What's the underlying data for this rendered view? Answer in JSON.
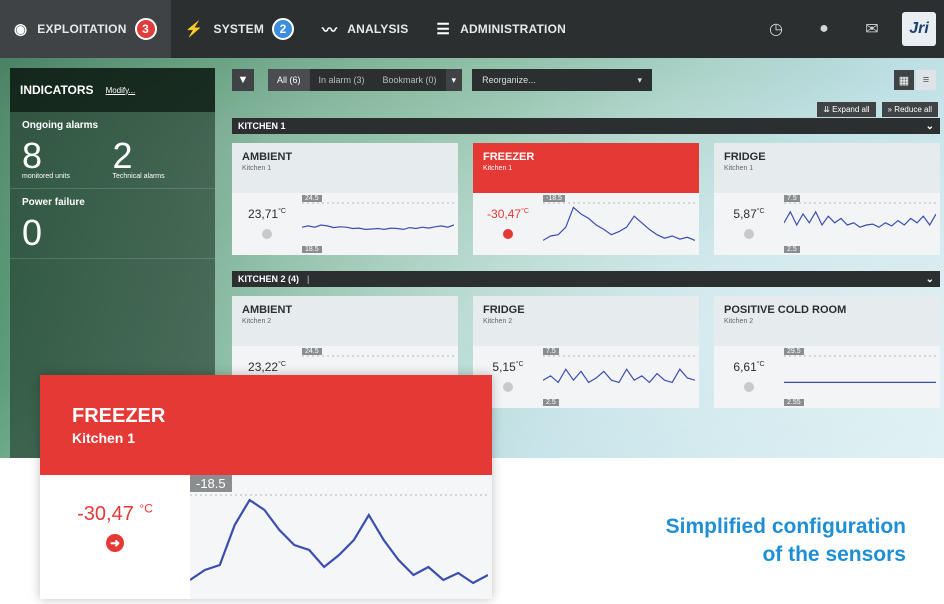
{
  "nav": {
    "exploitation": "EXPLOITATION",
    "exploitation_badge": "3",
    "system": "SYSTEM",
    "system_badge": "2",
    "analysis": "ANALYSIS",
    "administration": "ADMINISTRATION",
    "logo": "Jri",
    "icons": [
      "eye-icon",
      "bolt-icon",
      "chart-line-icon",
      "sliders-icon",
      "clock-icon",
      "user-icon",
      "mail-icon"
    ]
  },
  "indicators": {
    "title": "INDICATORS",
    "modify": "Modify...",
    "ongoing_alarms": "Ongoing alarms",
    "monitored_units_value": "8",
    "monitored_units_label": "monitored units",
    "technical_alarms_value": "2",
    "technical_alarms_label": "Technical alarms",
    "power_failure": "Power failure",
    "power_failure_value": "0"
  },
  "toolbar": {
    "tabs": [
      "All (6)",
      "In alarm (3)",
      "Bookmark (0)"
    ],
    "reorganize": "Reorganize...",
    "expand_all": "Expand all",
    "reduce_all": "Reduce all"
  },
  "groups": [
    {
      "title": "KITCHEN 1",
      "cards": [
        {
          "title": "AMBIENT",
          "sub": "Kitchen 1",
          "value": "23,71",
          "unit": "°C",
          "tick_top": "24.5",
          "tick_bot": "18.5",
          "alarm": false,
          "series": [
            0.55,
            0.52,
            0.55,
            0.5,
            0.52,
            0.56,
            0.54,
            0.55,
            0.58,
            0.57,
            0.6,
            0.59,
            0.58,
            0.6,
            0.57,
            0.58,
            0.6,
            0.56,
            0.58,
            0.55,
            0.57,
            0.54,
            0.52,
            0.55,
            0.5
          ]
        },
        {
          "title": "FREEZER",
          "sub": "Kitchen 1",
          "value": "-30,47",
          "unit": "°C",
          "tick_top": "-18.5",
          "tick_bot": "",
          "alarm": true,
          "series": [
            0.85,
            0.75,
            0.72,
            0.55,
            0.1,
            0.25,
            0.35,
            0.5,
            0.6,
            0.72,
            0.65,
            0.55,
            0.3,
            0.45,
            0.6,
            0.72,
            0.8,
            0.75,
            0.82,
            0.78,
            0.85
          ]
        },
        {
          "title": "FRIDGE",
          "sub": "Kitchen 1",
          "value": "5,87",
          "unit": "°C",
          "tick_top": "7.5",
          "tick_bot": "2.5",
          "alarm": false,
          "series": [
            0.45,
            0.2,
            0.5,
            0.25,
            0.45,
            0.2,
            0.5,
            0.3,
            0.45,
            0.35,
            0.5,
            0.45,
            0.55,
            0.5,
            0.48,
            0.55,
            0.45,
            0.52,
            0.4,
            0.5,
            0.35,
            0.45,
            0.3,
            0.5,
            0.25
          ]
        }
      ]
    },
    {
      "title": "KITCHEN 2 (4)",
      "cards": [
        {
          "title": "AMBIENT",
          "sub": "Kitchen 2",
          "value": "23,22",
          "unit": "°C",
          "tick_top": "24.5",
          "tick_bot": "",
          "alarm": false,
          "series": [
            0.6,
            0.5,
            0.58,
            0.45,
            0.6,
            0.52,
            0.58,
            0.5,
            0.6,
            0.55,
            0.6,
            0.52,
            0.62,
            0.55,
            0.6,
            0.58,
            0.62,
            0.55,
            0.6
          ]
        },
        {
          "title": "FRIDGE",
          "sub": "Kitchen 2",
          "value": "5,15",
          "unit": "°C",
          "tick_top": "7.5",
          "tick_bot": "2.5",
          "alarm": false,
          "series": [
            0.55,
            0.45,
            0.6,
            0.3,
            0.55,
            0.35,
            0.6,
            0.5,
            0.35,
            0.55,
            0.6,
            0.3,
            0.55,
            0.45,
            0.6,
            0.4,
            0.55,
            0.6,
            0.3,
            0.5,
            0.55
          ]
        },
        {
          "title": "POSITIVE COLD ROOM",
          "sub": "Kitchen 2",
          "value": "6,61",
          "unit": "°C",
          "tick_top": "29.5",
          "tick_bot": "2.55",
          "alarm": false,
          "series": [
            0.6,
            0.6,
            0.6,
            0.6,
            0.6,
            0.6,
            0.6,
            0.6,
            0.6,
            0.6
          ]
        }
      ]
    }
  ],
  "zoom": {
    "title": "FREEZER",
    "sub": "Kitchen 1",
    "value": "-30,47",
    "unit": "°C",
    "tick_top": "-18.5",
    "series": [
      0.85,
      0.75,
      0.7,
      0.3,
      0.05,
      0.15,
      0.35,
      0.5,
      0.55,
      0.72,
      0.6,
      0.45,
      0.2,
      0.45,
      0.65,
      0.8,
      0.72,
      0.85,
      0.78,
      0.88,
      0.8
    ]
  },
  "tagline": {
    "line1": "Simplified configuration",
    "line2": "of the sensors"
  },
  "colors": {
    "alarm": "#e53935",
    "accent_blue": "#1e8fd6",
    "chart_line": "#3b4fb0",
    "nav_bg": "#2c2f30"
  }
}
